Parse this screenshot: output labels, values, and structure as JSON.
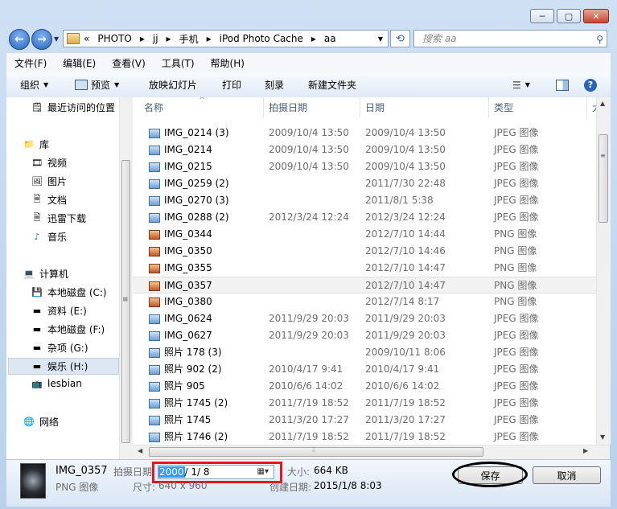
{
  "window": {
    "buttons": [
      "─",
      "▢",
      "✕"
    ]
  },
  "nav": {
    "back_icon": "back-arrow-icon",
    "forward_icon": "forward-arrow-icon",
    "address": [
      "«",
      "PHOTO",
      "▸",
      "jj",
      "▸",
      "手机",
      "▸",
      "iPod Photo Cache",
      "▸",
      "aa"
    ],
    "search_placeholder": "搜索 aa"
  },
  "menu": [
    "文件(F)",
    "编辑(E)",
    "查看(V)",
    "工具(T)",
    "帮助(H)"
  ],
  "toolbar": {
    "organize": "组织",
    "preview": "预览",
    "slideshow": "放映幻灯片",
    "print": "打印",
    "burn": "刻录",
    "new_folder": "新建文件夹"
  },
  "sidebar": {
    "recent": "最近访问的位置",
    "library": "库",
    "library_items": [
      "视频",
      "图片",
      "文档",
      "迅雷下载",
      "音乐"
    ],
    "computer": "计算机",
    "drives": [
      "本地磁盘 (C:)",
      "资料 (E:)",
      "本地磁盘 (F:)",
      "杂项 (G:)",
      "娱乐 (H:)",
      "lesbian"
    ],
    "network": "网络",
    "selected_index": 4
  },
  "columns": [
    "名称",
    "拍摄日期",
    "日期",
    "类型",
    "大"
  ],
  "files": [
    {
      "name": "IMG_0214 (3)",
      "taken": "2009/10/4 13:50",
      "date": "2009/10/4 13:50",
      "type": "JPEG 图像",
      "kind": "jpeg"
    },
    {
      "name": "IMG_0214",
      "taken": "2009/10/4 13:50",
      "date": "2009/10/4 13:50",
      "type": "JPEG 图像",
      "kind": "jpeg"
    },
    {
      "name": "IMG_0215",
      "taken": "2009/10/4 13:50",
      "date": "2009/10/4 13:50",
      "type": "JPEG 图像",
      "kind": "jpeg"
    },
    {
      "name": "IMG_0259 (2)",
      "taken": "",
      "date": "2011/7/30 22:48",
      "type": "JPEG 图像",
      "kind": "jpeg"
    },
    {
      "name": "IMG_0270 (3)",
      "taken": "",
      "date": "2011/8/1 5:38",
      "type": "JPEG 图像",
      "kind": "jpeg"
    },
    {
      "name": "IMG_0288 (2)",
      "taken": "2012/3/24 12:24",
      "date": "2012/3/24 12:24",
      "type": "JPEG 图像",
      "kind": "jpeg"
    },
    {
      "name": "IMG_0344",
      "taken": "",
      "date": "2012/7/10 14:44",
      "type": "PNG 图像",
      "kind": "png"
    },
    {
      "name": "IMG_0350",
      "taken": "",
      "date": "2012/7/10 14:46",
      "type": "PNG 图像",
      "kind": "png"
    },
    {
      "name": "IMG_0355",
      "taken": "",
      "date": "2012/7/10 14:47",
      "type": "PNG 图像",
      "kind": "png"
    },
    {
      "name": "IMG_0357",
      "taken": "",
      "date": "2012/7/10 14:47",
      "type": "PNG 图像",
      "kind": "png",
      "selected": true
    },
    {
      "name": "IMG_0380",
      "taken": "",
      "date": "2012/7/14 8:17",
      "type": "PNG 图像",
      "kind": "png"
    },
    {
      "name": "IMG_0624",
      "taken": "2011/9/29 20:03",
      "date": "2011/9/29 20:03",
      "type": "JPEG 图像",
      "kind": "jpeg"
    },
    {
      "name": "IMG_0627",
      "taken": "2011/9/29 20:03",
      "date": "2011/9/29 20:03",
      "type": "JPEG 图像",
      "kind": "jpeg"
    },
    {
      "name": "照片 178 (3)",
      "taken": "",
      "date": "2009/10/11 8:06",
      "type": "JPEG 图像",
      "kind": "jpeg"
    },
    {
      "name": "照片 902 (2)",
      "taken": "2010/4/17 9:41",
      "date": "2010/4/17 9:41",
      "type": "JPEG 图像",
      "kind": "jpeg"
    },
    {
      "name": "照片 905",
      "taken": "2010/6/6 14:02",
      "date": "2010/6/6 14:02",
      "type": "JPEG 图像",
      "kind": "jpeg"
    },
    {
      "name": "照片 1745 (2)",
      "taken": "2011/7/19 18:52",
      "date": "2011/7/19 18:52",
      "type": "JPEG 图像",
      "kind": "jpeg"
    },
    {
      "name": "照片 1745",
      "taken": "2011/3/20 17:27",
      "date": "2011/3/20 17:27",
      "type": "JPEG 图像",
      "kind": "jpeg"
    },
    {
      "name": "照片 1746 (2)",
      "taken": "2011/7/19 18:52",
      "date": "2011/7/19 18:52",
      "type": "JPEG 图像",
      "kind": "jpeg"
    }
  ],
  "details": {
    "filename": "IMG_0357",
    "filetype": "PNG 图像",
    "taken_label": "拍摄日期:",
    "taken_year": "2000",
    "taken_rest": "/  1/  8",
    "size_label": "尺寸:",
    "size_value": "640 x 960",
    "filesize_label": "大小:",
    "filesize_value": "664 KB",
    "created_label": "创建日期:",
    "created_value": "2015/1/8 8:03"
  },
  "buttons": {
    "save": "保存",
    "cancel": "取消"
  }
}
